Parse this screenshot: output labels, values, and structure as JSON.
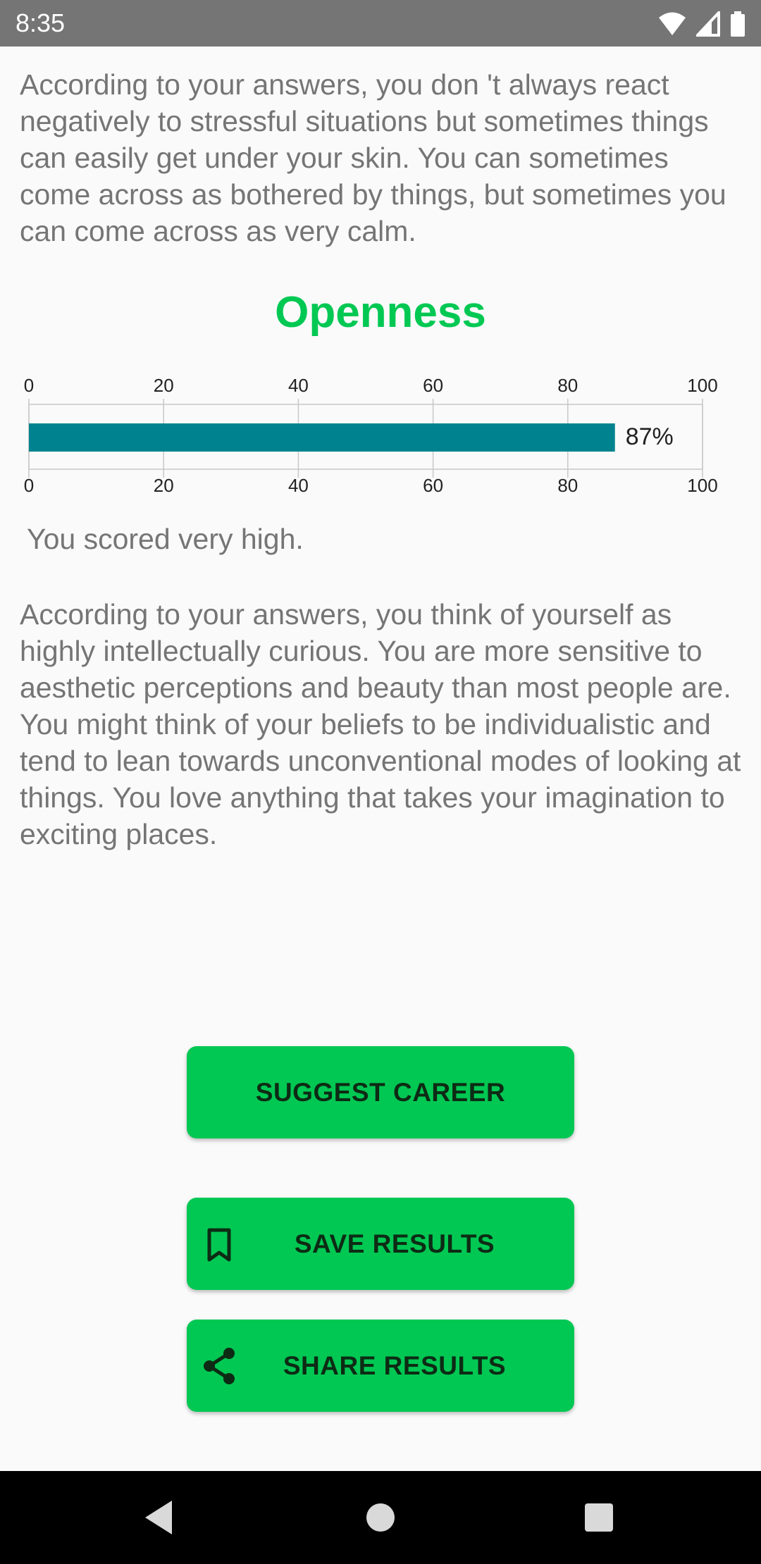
{
  "status_bar": {
    "time": "8:35"
  },
  "content": {
    "intro_paragraph": " According to your answers, you don 't always react negatively to stressful situations but sometimes things can easily get under your skin. You can sometimes come across as bothered by things, but sometimes you can come across as very calm.",
    "section_title": "Openness",
    "score_text": "You scored very high.",
    "detail_paragraph": "According to your answers, you think of yourself as highly intellectually curious. You are more sensitive to aesthetic perceptions and beauty than most people are. You might think of your beliefs to be individualistic and tend to lean towards unconventional modes of looking at things. You love anything that takes your imagination to exciting places."
  },
  "chart_data": {
    "type": "bar",
    "orientation": "horizontal",
    "values": [
      87
    ],
    "value_labels": [
      "87%"
    ],
    "xlim": [
      0,
      100
    ],
    "ticks_top": [
      "0",
      "20",
      "40",
      "60",
      "80",
      "100"
    ],
    "ticks_bottom": [
      "0",
      "20",
      "40",
      "60",
      "80",
      "100"
    ],
    "bar_color": "#00838f",
    "grid": true
  },
  "buttons": {
    "suggest_career": "SUGGEST CAREER",
    "save_results": "SAVE RESULTS",
    "share_results": "SHARE RESULTS"
  },
  "icons": {
    "save": "bookmark-icon",
    "share": "share-icon"
  },
  "colors": {
    "accent": "#00c853",
    "text": "#757575",
    "bar": "#00838f"
  }
}
